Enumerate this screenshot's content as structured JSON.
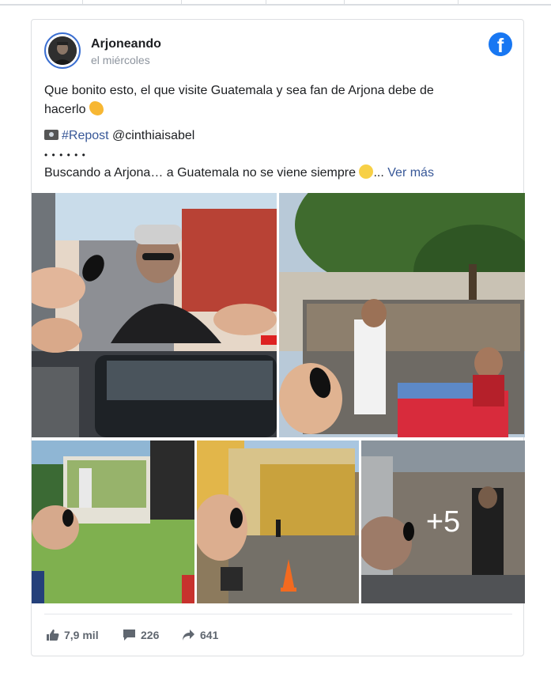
{
  "post": {
    "author": "Arjoneando",
    "time": "el miércoles",
    "line1": "Que bonito esto, el que visite Guatemala y sea fan de Arjona debe de",
    "line2": "hacerlo",
    "hashtag": "#Repost",
    "mention": "@cinthiaisabel",
    "dots": "• • • • • •",
    "line4": "Buscando a Arjona… a Guatemala no se viene siempre",
    "ellipsis": "...",
    "see_more": "Ver más",
    "more_photos": "+5"
  },
  "stats": {
    "likes": "7,9 mil",
    "comments": "226",
    "shares": "641"
  },
  "icons": {
    "brand": "facebook-icon",
    "like": "thumbs-up-icon",
    "comment": "comment-icon",
    "share": "share-arrow-icon",
    "camera": "camera-emoji",
    "clap": "clapping-hands-emoji",
    "sad": "sad-face-emoji"
  },
  "colors": {
    "brand": "#1877f2",
    "link": "#385898",
    "text": "#1c1e21",
    "muted": "#8d949e"
  }
}
